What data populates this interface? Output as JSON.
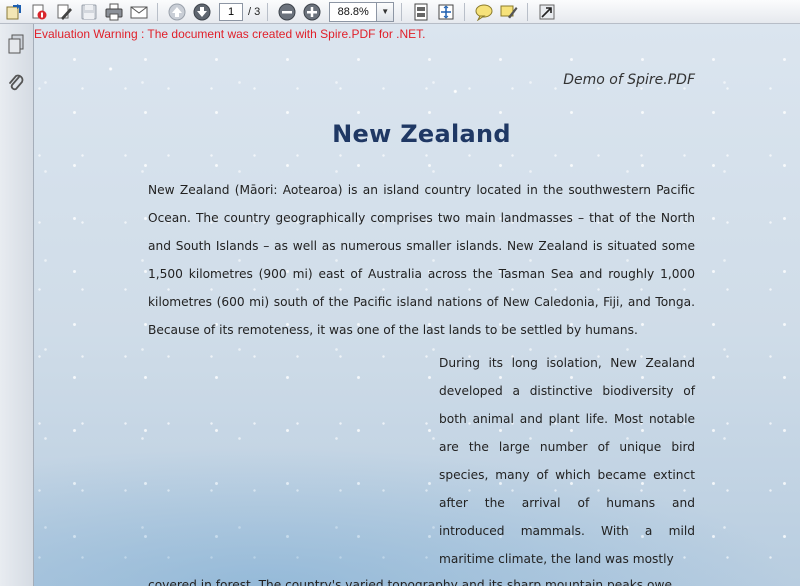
{
  "toolbar": {
    "page_current": "1",
    "page_total": "/ 3",
    "zoom": "88.8%"
  },
  "document": {
    "warning": "Evaluation Warning : The document was created with Spire.PDF for .NET.",
    "header": "Demo of Spire.PDF",
    "title": "New Zealand",
    "paragraph_1": "New Zealand (Māori: Aotearoa) is an island country located in the southwestern Pacific Ocean. The country geographically comprises two main landmasses – that of the North and South Islands – as well as numerous smaller islands. New Zealand is situated some 1,500 kilometres (900 mi) east of Australia across the Tasman Sea and roughly 1,000 kilometres (600 mi) south of the Pacific island nations of New Caledonia, Fiji, and Tonga. Because of its remoteness, it was one of the last lands to be settled by humans.",
    "paragraph_2": "During its long isolation, New Zealand developed a distinctive biodiversity of both animal and plant life. Most notable are the large number of unique bird species, many of which became extinct after the arrival of humans and introduced mammals. With a mild maritime climate, the land was mostly",
    "paragraph_3_partial": "covered in forest. The country's varied topography and its sharp mountain peaks owe"
  },
  "icons": [
    "open-icon",
    "properties-icon",
    "edit-icon",
    "save-icon",
    "print-icon",
    "email-icon",
    "previous-page-icon",
    "next-page-icon",
    "zoom-out-icon",
    "zoom-in-icon",
    "single-page-icon",
    "fit-page-icon",
    "comment-icon",
    "highlight-icon",
    "expand-icon",
    "pages-panel-icon",
    "attachments-icon"
  ]
}
